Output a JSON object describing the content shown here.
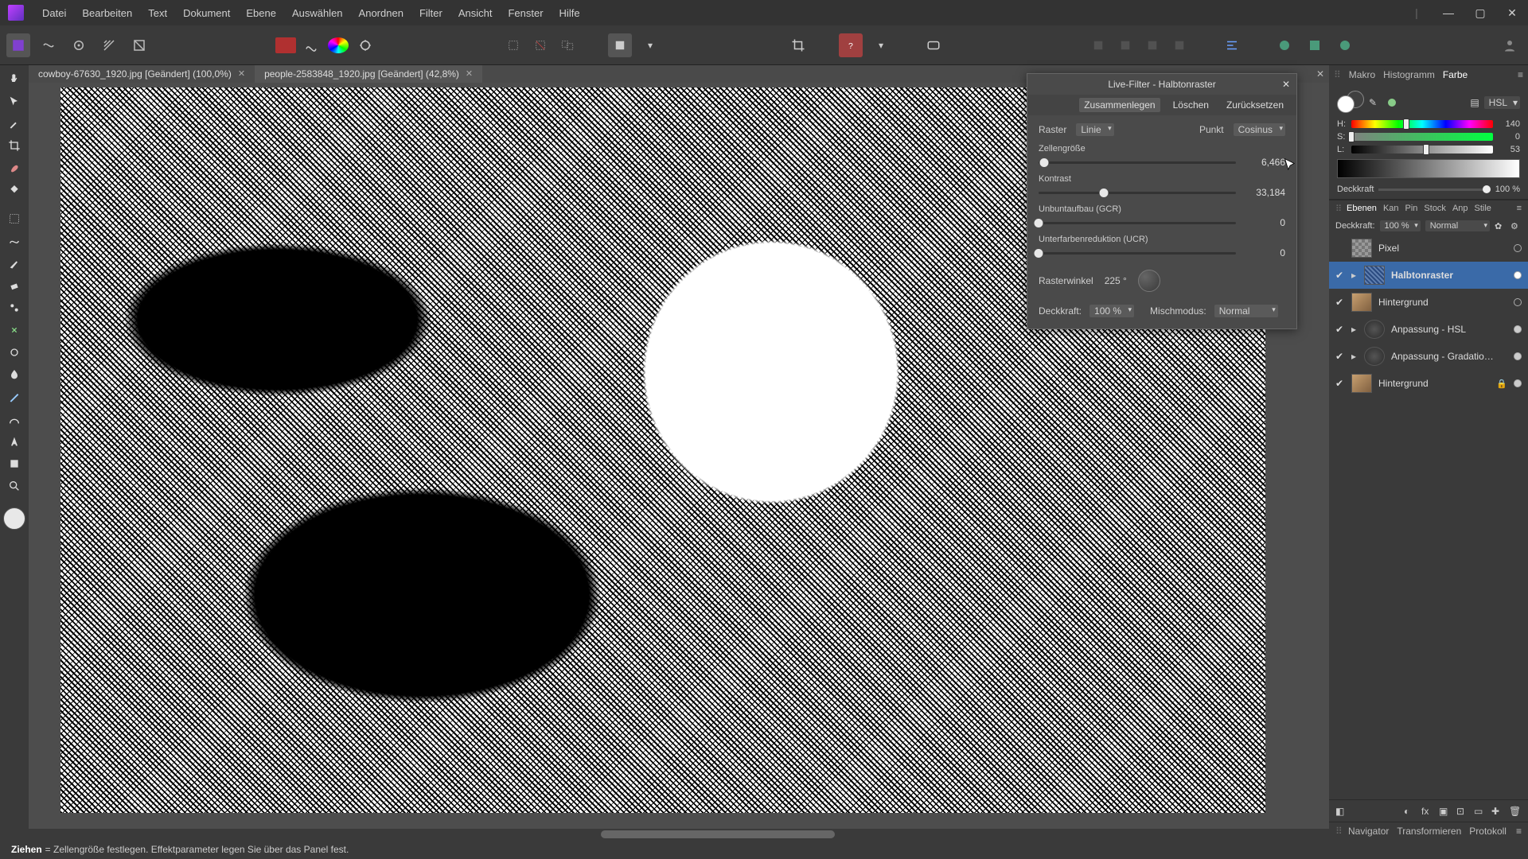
{
  "menu": {
    "items": [
      "Datei",
      "Bearbeiten",
      "Text",
      "Dokument",
      "Ebene",
      "Auswählen",
      "Anordnen",
      "Filter",
      "Ansicht",
      "Fenster",
      "Hilfe"
    ]
  },
  "tabs": {
    "0": {
      "label": "cowboy-67630_1920.jpg [Geändert] (100,0%)"
    },
    "1": {
      "label": "people-2583848_1920.jpg [Geändert] (42,8%)"
    }
  },
  "livefilter": {
    "title": "Live-Filter - Halbtonraster",
    "btn_merge": "Zusammenlegen",
    "btn_delete": "Löschen",
    "btn_reset": "Zurücksetzen",
    "raster_label": "Raster",
    "raster_value": "Linie",
    "point_label": "Punkt",
    "point_value": "Cosinus",
    "cell_label": "Zellengröße",
    "cell_value": "6,466",
    "contrast_label": "Kontrast",
    "contrast_value": "33,184",
    "gcr_label": "Unbuntaufbau (GCR)",
    "gcr_value": "0",
    "ucr_label": "Unterfarbenreduktion (UCR)",
    "ucr_value": "0",
    "angle_label": "Rasterwinkel",
    "angle_value": "225 °",
    "opacity_label": "Deckkraft:",
    "opacity_value": "100 %",
    "blend_label": "Mischmodus:",
    "blend_value": "Normal"
  },
  "rightpanel": {
    "tabs1": {
      "0": "Makro",
      "1": "Histogramm",
      "2": "Farbe"
    },
    "color_mode": "HSL",
    "hsl": {
      "h_label": "H:",
      "h_value": "140",
      "s_label": "S:",
      "s_value": "0",
      "l_label": "L:",
      "l_value": "53"
    },
    "opacity_label": "Deckkraft",
    "opacity_value": "100 %",
    "layertabs": {
      "0": "Ebenen",
      "1": "Kan",
      "2": "Pin",
      "3": "Stock",
      "4": "Anp",
      "5": "Stile"
    },
    "layer_opacity_label": "Deckkraft:",
    "layer_opacity_value": "100 %",
    "layer_blend": "Normal",
    "layers": {
      "0": {
        "name": "Pixel"
      },
      "1": {
        "name": "Halbtonraster"
      },
      "2": {
        "name": "Hintergrund"
      },
      "3": {
        "name": "Anpassung - HSL"
      },
      "4": {
        "name": "Anpassung - Gradatio…"
      },
      "5": {
        "name": "Hintergrund"
      }
    },
    "navtabs": {
      "0": "Navigator",
      "1": "Transformieren",
      "2": "Protokoll"
    }
  },
  "status": {
    "bold": "Ziehen",
    "text": " = Zellengröße festlegen. Effektparameter legen Sie über das Panel fest."
  }
}
